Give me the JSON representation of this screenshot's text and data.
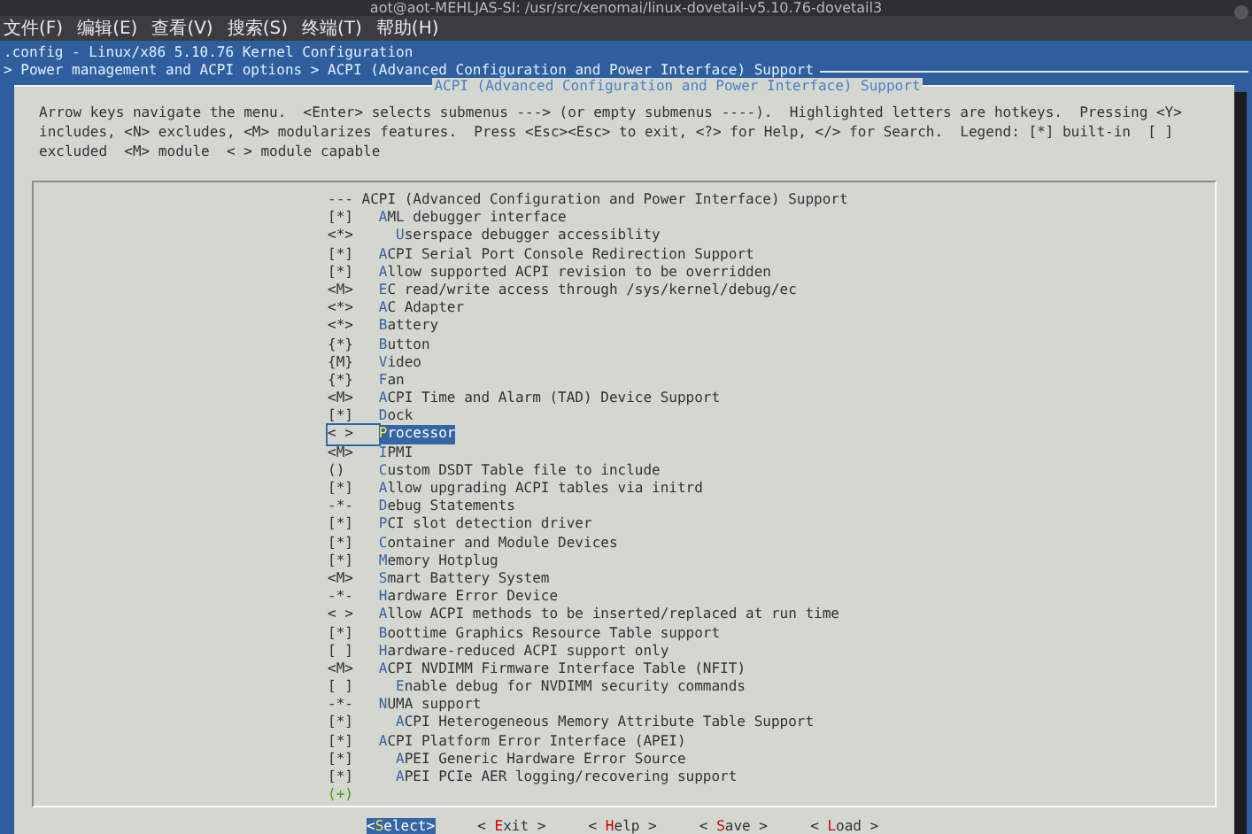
{
  "window": {
    "title": "aot@aot-MEHLJAS-SI: /usr/src/xenomai/linux-dovetail-v5.10.76-dovetail3"
  },
  "menu_bar": [
    "文件(F)",
    "编辑(E)",
    "查看(V)",
    "搜索(S)",
    "终端(T)",
    "帮助(H)"
  ],
  "terminal": {
    "config_line": ".config - Linux/x86 5.10.76 Kernel Configuration",
    "breadcrumb": "> Power management and ACPI options > ACPI (Advanced Configuration and Power Interface) Support"
  },
  "dialog": {
    "title": "ACPI (Advanced Configuration and Power Interface) Support",
    "help_lines": [
      "Arrow keys navigate the menu.  <Enter> selects submenus ---> (or empty submenus ----).  Highlighted letters are hotkeys.  Pressing <Y>",
      "includes, <N> excludes, <M> modularizes features.  Press <Esc><Esc> to exit, <?> for Help, </> for Search.  Legend: [*] built-in  [ ]",
      "excluded  <M> module  < > module capable"
    ],
    "items": [
      {
        "kind": "comment",
        "prefix": "---",
        "label": "ACPI (Advanced Configuration and Power Interface) Support",
        "selected": false
      },
      {
        "kind": "option",
        "prefix": "[*]",
        "label": "AML debugger interface",
        "selected": false,
        "children": [
          {
            "kind": "option",
            "prefix": "<*>",
            "label": "Userspace debugger accessiblity",
            "selected": false
          }
        ]
      },
      {
        "kind": "option",
        "prefix": "[*]",
        "label": "ACPI Serial Port Console Redirection Support",
        "selected": false
      },
      {
        "kind": "option",
        "prefix": "[*]",
        "label": "Allow supported ACPI revision to be overridden",
        "selected": false
      },
      {
        "kind": "option",
        "prefix": "<M>",
        "label": "EC read/write access through /sys/kernel/debug/ec",
        "selected": false
      },
      {
        "kind": "option",
        "prefix": "<*>",
        "label": "AC Adapter",
        "selected": false
      },
      {
        "kind": "option",
        "prefix": "<*>",
        "label": "Battery",
        "selected": false
      },
      {
        "kind": "option",
        "prefix": "{*}",
        "label": "Button",
        "selected": false
      },
      {
        "kind": "option",
        "prefix": "{M}",
        "label": "Video",
        "selected": false
      },
      {
        "kind": "option",
        "prefix": "{*}",
        "label": "Fan",
        "selected": false
      },
      {
        "kind": "option",
        "prefix": "<M>",
        "label": "ACPI Time and Alarm (TAD) Device Support",
        "selected": false
      },
      {
        "kind": "option",
        "prefix": "[*]",
        "label": "Dock",
        "selected": false
      },
      {
        "kind": "option",
        "prefix": "< >",
        "label": "Processor",
        "selected": true
      },
      {
        "kind": "option",
        "prefix": "<M>",
        "label": "IPMI",
        "selected": false
      },
      {
        "kind": "option",
        "prefix": "()",
        "label": "Custom DSDT Table file to include",
        "selected": false
      },
      {
        "kind": "option",
        "prefix": "[*]",
        "label": "Allow upgrading ACPI tables via initrd",
        "selected": false
      },
      {
        "kind": "option",
        "prefix": "-*-",
        "label": "Debug Statements",
        "selected": false
      },
      {
        "kind": "option",
        "prefix": "[*]",
        "label": "PCI slot detection driver",
        "selected": false
      },
      {
        "kind": "option",
        "prefix": "[*]",
        "label": "Container and Module Devices",
        "selected": false
      },
      {
        "kind": "option",
        "prefix": "[*]",
        "label": "Memory Hotplug",
        "selected": false
      },
      {
        "kind": "option",
        "prefix": "<M>",
        "label": "Smart Battery System",
        "selected": false
      },
      {
        "kind": "option",
        "prefix": "-*-",
        "label": "Hardware Error Device",
        "selected": false
      },
      {
        "kind": "option",
        "prefix": "< >",
        "label": "Allow ACPI methods to be inserted/replaced at run time",
        "selected": false
      },
      {
        "kind": "option",
        "prefix": "[*]",
        "label": "Boottime Graphics Resource Table support",
        "selected": false
      },
      {
        "kind": "option",
        "prefix": "[ ]",
        "label": "Hardware-reduced ACPI support only",
        "selected": false
      },
      {
        "kind": "option",
        "prefix": "<M>",
        "label": "ACPI NVDIMM Firmware Interface Table (NFIT)",
        "selected": false,
        "children": [
          {
            "kind": "option",
            "prefix": "[ ]",
            "label": "Enable debug for NVDIMM security commands",
            "selected": false
          }
        ]
      },
      {
        "kind": "option",
        "prefix": "-*-",
        "label": "NUMA support",
        "selected": false,
        "children": [
          {
            "kind": "option",
            "prefix": "[*]",
            "label": "ACPI Heterogeneous Memory Attribute Table Support",
            "selected": false
          }
        ]
      },
      {
        "kind": "option",
        "prefix": "[*]",
        "label": "ACPI Platform Error Interface (APEI)",
        "selected": false,
        "children": [
          {
            "kind": "option",
            "prefix": "[*]",
            "label": "APEI Generic Hardware Error Source",
            "selected": false
          },
          {
            "kind": "option",
            "prefix": "[*]",
            "label": "APEI PCIe AER logging/recovering support",
            "selected": false
          }
        ]
      }
    ],
    "more_indicator": "(+)",
    "buttons": [
      {
        "label": "<Select>",
        "selected": true
      },
      {
        "label": "< Exit >",
        "selected": false
      },
      {
        "label": "< Help >",
        "selected": false
      },
      {
        "label": "< Save >",
        "selected": false
      },
      {
        "label": "< Load >",
        "selected": false
      }
    ]
  }
}
